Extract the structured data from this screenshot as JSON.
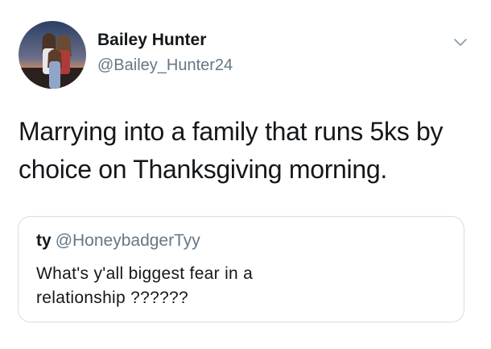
{
  "tweet": {
    "display_name": "Bailey Hunter",
    "handle": "@Bailey_Hunter24",
    "avatar_icon": "profile-photo",
    "menu_icon": "chevron-down-icon",
    "text_lines": [
      "Marrying into a family that runs 5ks by",
      "choice on Thanksgiving morning."
    ]
  },
  "quoted_tweet": {
    "display_name": "ty",
    "handle": "@HoneybadgerTyy",
    "text_lines": [
      "What's y'all biggest fear in a",
      "relationship ??????"
    ]
  },
  "colors": {
    "text": "#14171a",
    "secondary": "#657786",
    "border": "#d5dde3"
  }
}
